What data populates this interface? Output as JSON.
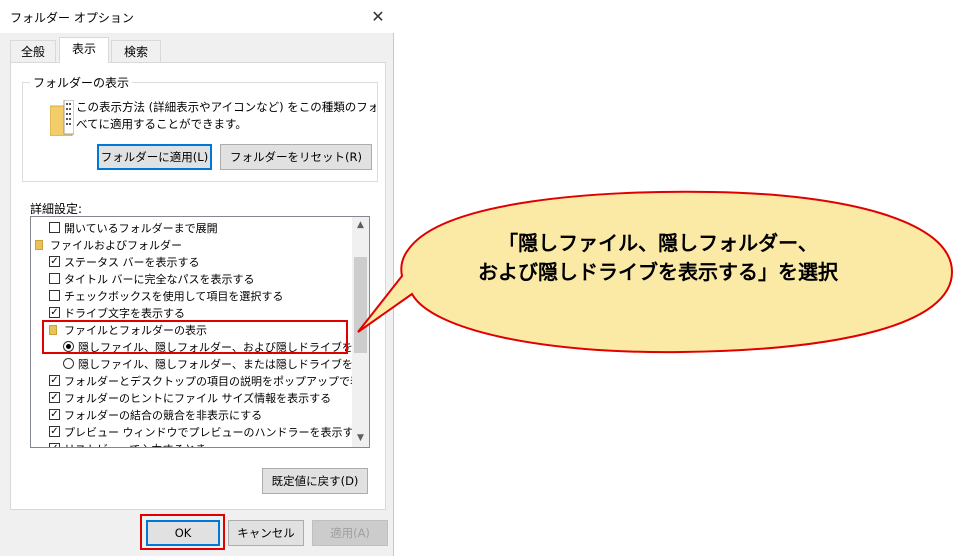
{
  "dialog": {
    "title": "フォルダー オプション",
    "tabs": [
      {
        "label": "全般"
      },
      {
        "label": "表示"
      },
      {
        "label": "検索"
      }
    ],
    "folder_view": {
      "group_label": "フォルダーの表示",
      "description_line1": "この表示方法 (詳細表示やアイコンなど) をこの種類のフォルダーす",
      "description_line2": "べてに適用することができます。",
      "apply_button": "フォルダーに適用(L)",
      "reset_button": "フォルダーをリセット(R)"
    },
    "advanced": {
      "label": "詳細設定:",
      "items": [
        {
          "type": "checkbox",
          "checked": false,
          "label": "開いているフォルダーまで展開",
          "indent": 1
        },
        {
          "type": "folder",
          "label": "ファイルおよびフォルダー",
          "indent": 0
        },
        {
          "type": "checkbox",
          "checked": true,
          "label": "ステータス バーを表示する",
          "indent": 1
        },
        {
          "type": "checkbox",
          "checked": false,
          "label": "タイトル バーに完全なパスを表示する",
          "indent": 1
        },
        {
          "type": "checkbox",
          "checked": false,
          "label": "チェックボックスを使用して項目を選択する",
          "indent": 1
        },
        {
          "type": "checkbox",
          "checked": true,
          "label": "ドライブ文字を表示する",
          "indent": 1
        },
        {
          "type": "folder",
          "label": "ファイルとフォルダーの表示",
          "indent": 1
        },
        {
          "type": "radio",
          "checked": true,
          "label": "隠しファイル、隠しフォルダー、および隠しドライブを表示する",
          "indent": 2
        },
        {
          "type": "radio",
          "checked": false,
          "label": "隠しファイル、隠しフォルダー、または隠しドライブを表示しない",
          "indent": 2
        },
        {
          "type": "checkbox",
          "checked": true,
          "label": "フォルダーとデスクトップの項目の説明をポップアップで表示する",
          "indent": 1
        },
        {
          "type": "checkbox",
          "checked": true,
          "label": "フォルダーのヒントにファイル サイズ情報を表示する",
          "indent": 1
        },
        {
          "type": "checkbox",
          "checked": true,
          "label": "フォルダーの結合の競合を非表示にする",
          "indent": 1
        },
        {
          "type": "checkbox",
          "checked": true,
          "label": "プレビュー ウィンドウでプレビューのハンドラーを表示する",
          "indent": 1
        },
        {
          "type": "checkbox",
          "checked": true,
          "label": "リストビューで入力するとき",
          "indent": 1
        }
      ],
      "restore_button": "既定値に戻す(D)"
    },
    "ok_button": "OK",
    "cancel_button": "キャンセル",
    "apply_button": "適用(A)",
    "close_glyph": "✕"
  },
  "callout": {
    "line1": "「隠しファイル、隠しフォルダー、",
    "line2": "および隠しドライブを表示する」を選択"
  },
  "colors": {
    "highlight_red": "#e00000",
    "callout_fill": "#fbeaa5",
    "accent_blue": "#0078d7"
  }
}
